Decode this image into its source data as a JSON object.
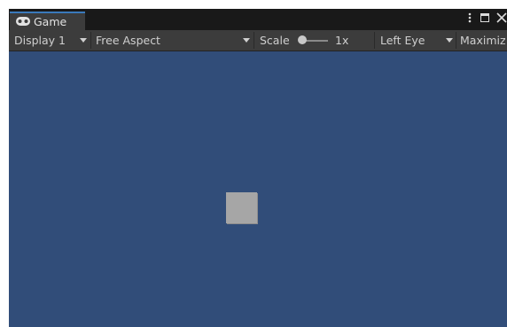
{
  "tab": {
    "label": "Game",
    "icon": "gamepad-icon",
    "accent_color": "#3a79bb"
  },
  "window_controls": {
    "menu_icon": "kebab-menu-icon",
    "maximize_icon": "maximize-icon",
    "close_icon": "close-icon"
  },
  "toolbar": {
    "display": "Display 1",
    "aspect": "Free Aspect",
    "scale_label": "Scale",
    "scale_value": "1x",
    "eye": "Left Eye",
    "maximize": "Maximiz"
  },
  "viewport": {
    "background_color": "#314d79",
    "object_color": "#a6a6a6"
  }
}
